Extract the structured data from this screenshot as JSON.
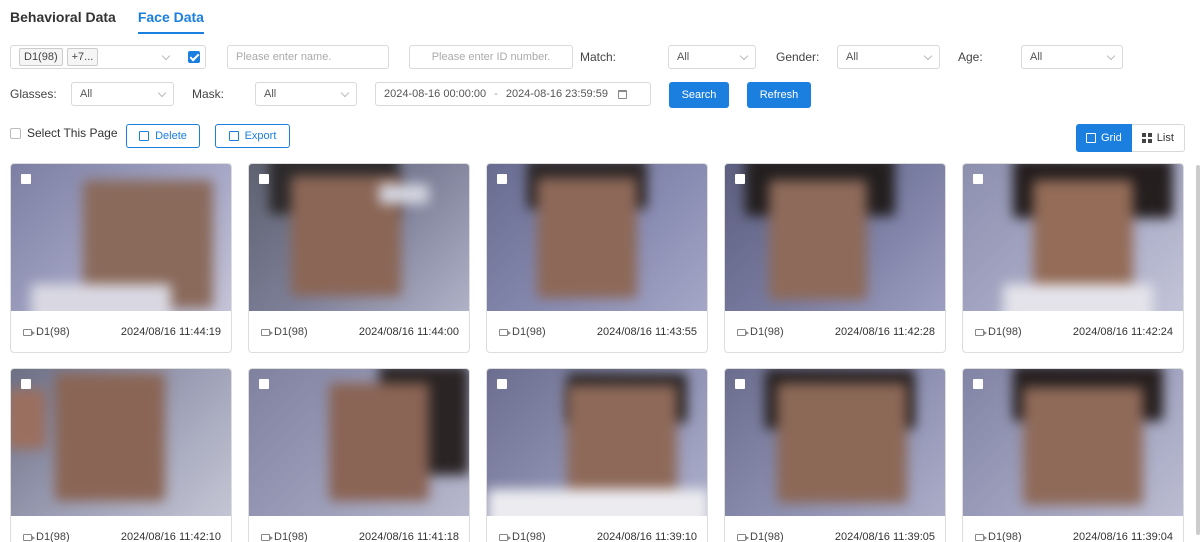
{
  "tabs": [
    {
      "label": "Behavioral Data",
      "active": false
    },
    {
      "label": "Face Data",
      "active": true
    }
  ],
  "filters": {
    "channel_tag": "D1(98)",
    "channel_more": "+7...",
    "name_placeholder": "Please enter name.",
    "id_placeholder": "Please enter ID number.",
    "match_label": "Match:",
    "match_value": "All",
    "gender_label": "Gender:",
    "gender_value": "All",
    "age_label": "Age:",
    "age_value": "All",
    "glasses_label": "Glasses:",
    "glasses_value": "All",
    "mask_label": "Mask:",
    "mask_value": "All",
    "date_start": "2024-08-16 00:00:00",
    "date_sep": "-",
    "date_end": "2024-08-16 23:59:59",
    "search_label": "Search",
    "refresh_label": "Refresh"
  },
  "actions": {
    "select_page_label": "Select This Page",
    "delete_label": "Delete",
    "export_label": "Export",
    "grid_label": "Grid",
    "list_label": "List"
  },
  "colors": {
    "accent": "#1b7fe0"
  },
  "cards": [
    {
      "channel": "D1(98)",
      "time": "2024/08/16 11:44:19"
    },
    {
      "channel": "D1(98)",
      "time": "2024/08/16 11:44:00"
    },
    {
      "channel": "D1(98)",
      "time": "2024/08/16 11:43:55"
    },
    {
      "channel": "D1(98)",
      "time": "2024/08/16 11:42:28"
    },
    {
      "channel": "D1(98)",
      "time": "2024/08/16 11:42:24"
    },
    {
      "channel": "D1(98)",
      "time": "2024/08/16 11:42:10"
    },
    {
      "channel": "D1(98)",
      "time": "2024/08/16 11:41:18"
    },
    {
      "channel": "D1(98)",
      "time": "2024/08/16 11:39:10"
    },
    {
      "channel": "D1(98)",
      "time": "2024/08/16 11:39:05"
    },
    {
      "channel": "D1(98)",
      "time": "2024/08/16 11:39:04"
    }
  ]
}
